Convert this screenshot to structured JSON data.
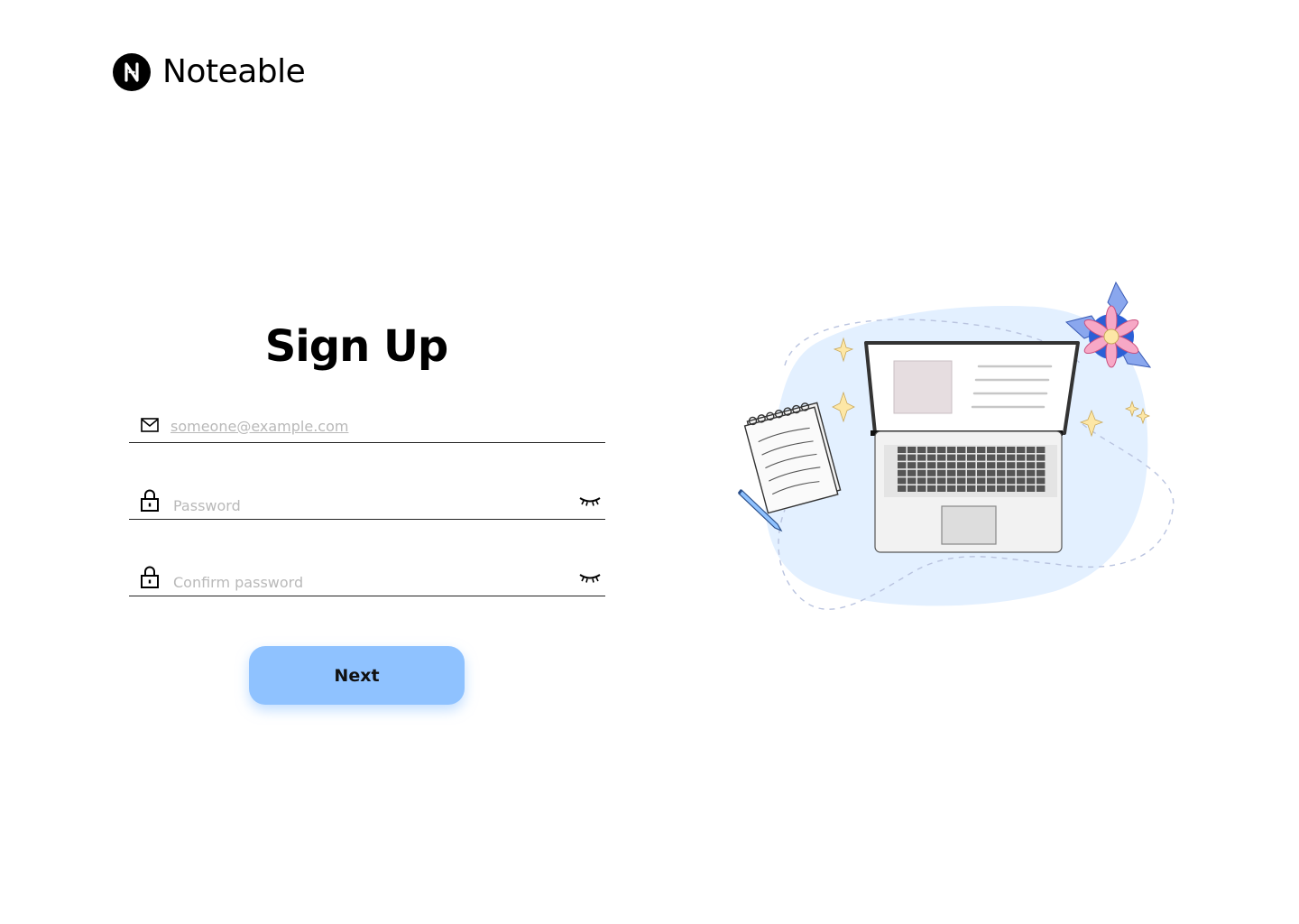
{
  "brand": {
    "name": "Noteable",
    "logo_letter": "N",
    "logo_icon": "noteable-logo-icon"
  },
  "signup": {
    "title": "Sign Up",
    "email": {
      "icon": "envelope-icon",
      "placeholder": "someone@example.com",
      "value": ""
    },
    "password": {
      "icon": "lock-icon",
      "placeholder": "Password",
      "value": "",
      "toggle_icon": "eye-closed-icon"
    },
    "confirm_password": {
      "icon": "lock-icon",
      "placeholder": "Confirm password",
      "value": "",
      "toggle_icon": "eye-closed-icon"
    },
    "next_label": "Next"
  },
  "illustration": {
    "description_icon": "laptop-notebook-flower-illustration",
    "colors": {
      "blob": "#e3f0ff",
      "accent": "#8fc2ff",
      "flower": "#f7a8c6",
      "leaf": "#6a8ee8"
    }
  },
  "colors": {
    "button_bg": "#8fc2ff",
    "text": "#000000",
    "placeholder": "#b9b9b9",
    "divider": "#222222"
  }
}
